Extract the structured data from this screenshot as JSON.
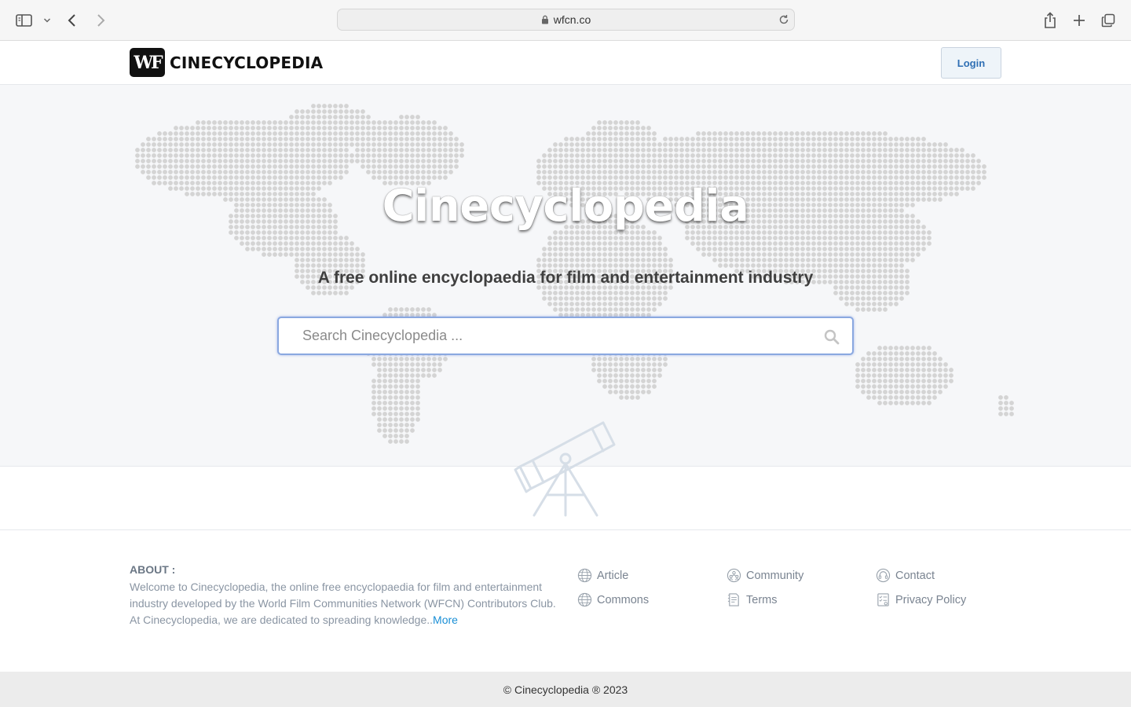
{
  "browser": {
    "url": "wfcn.co"
  },
  "header": {
    "logo_mark": "WF",
    "logo_text": "CINECYCLOPEDIA",
    "login_label": "Login"
  },
  "hero": {
    "title": "Cinecyclopedia",
    "subtitle": "A free online encyclopaedia for film and entertainment industry",
    "search_placeholder": "Search Cinecyclopedia ..."
  },
  "footer": {
    "about_title": "ABOUT :",
    "about_text": "Welcome to Cinecyclopedia, the online free encyclopaedia for film and entertainment industry developed by the World Film Communities Network (WFCN) Contributors Club. At Cinecyclopedia, we are dedicated to spreading knowledge..",
    "about_more": "More",
    "links": [
      {
        "label": "Article",
        "icon": "globe-icon"
      },
      {
        "label": "Community",
        "icon": "community-icon"
      },
      {
        "label": "Contact",
        "icon": "headset-icon"
      },
      {
        "label": "Commons",
        "icon": "globe-icon"
      },
      {
        "label": "Terms",
        "icon": "document-icon"
      },
      {
        "label": "Privacy Policy",
        "icon": "checklist-icon"
      }
    ],
    "copyright": "© Cinecyclopedia ® 2023"
  }
}
